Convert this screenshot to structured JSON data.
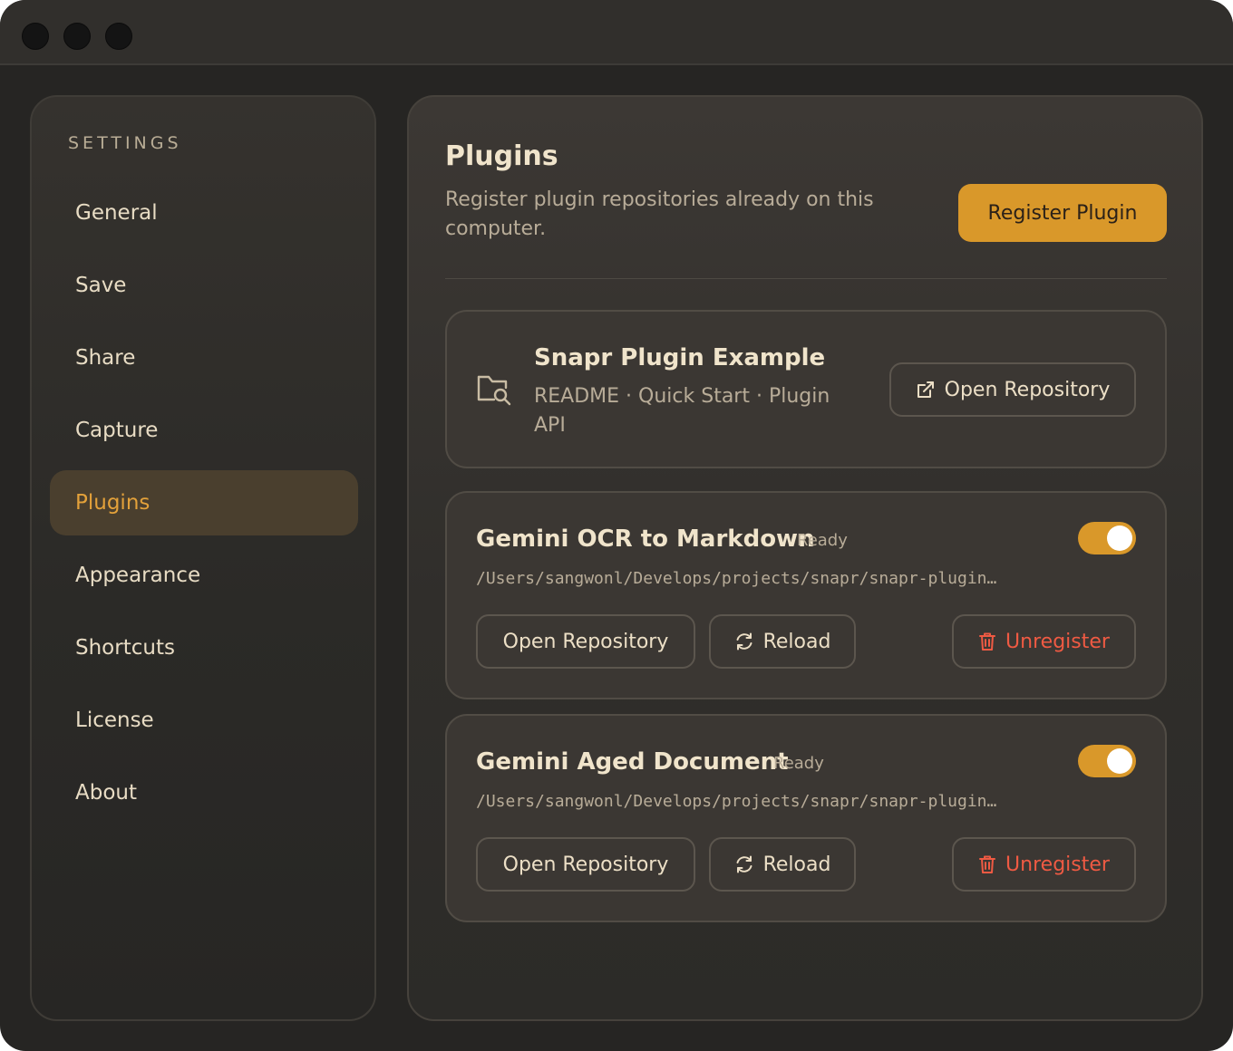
{
  "sidebar": {
    "heading": "SETTINGS",
    "items": [
      {
        "label": "General",
        "active": false
      },
      {
        "label": "Save",
        "active": false
      },
      {
        "label": "Share",
        "active": false
      },
      {
        "label": "Capture",
        "active": false
      },
      {
        "label": "Plugins",
        "active": true
      },
      {
        "label": "Appearance",
        "active": false
      },
      {
        "label": "Shortcuts",
        "active": false
      },
      {
        "label": "License",
        "active": false
      },
      {
        "label": "About",
        "active": false
      }
    ]
  },
  "main": {
    "title": "Plugins",
    "subtitle": "Register plugin repositories already on this computer.",
    "register_button": "Register Plugin",
    "example": {
      "icon": "folder-search-icon",
      "title": "Snapr Plugin Example",
      "links": "README · Quick Start · Plugin API",
      "open_button": "Open Repository",
      "open_icon": "external-link-icon"
    },
    "plugins": [
      {
        "name": "Gemini OCR to Markdown",
        "status": "Ready",
        "path": "/Users/sangwonl/Develops/projects/snapr/snapr-plugin…",
        "enabled": true,
        "open_button": "Open Repository",
        "reload_button": "Reload",
        "unregister_button": "Unregister"
      },
      {
        "name": "Gemini Aged Document",
        "status": "Ready",
        "path": "/Users/sangwonl/Develops/projects/snapr/snapr-plugin…",
        "enabled": true,
        "open_button": "Open Repository",
        "reload_button": "Reload",
        "unregister_button": "Unregister"
      }
    ]
  },
  "colors": {
    "accent": "#d9982a",
    "active_nav_text": "#e3a13a",
    "danger": "#ef5a43",
    "background": "#262523"
  }
}
